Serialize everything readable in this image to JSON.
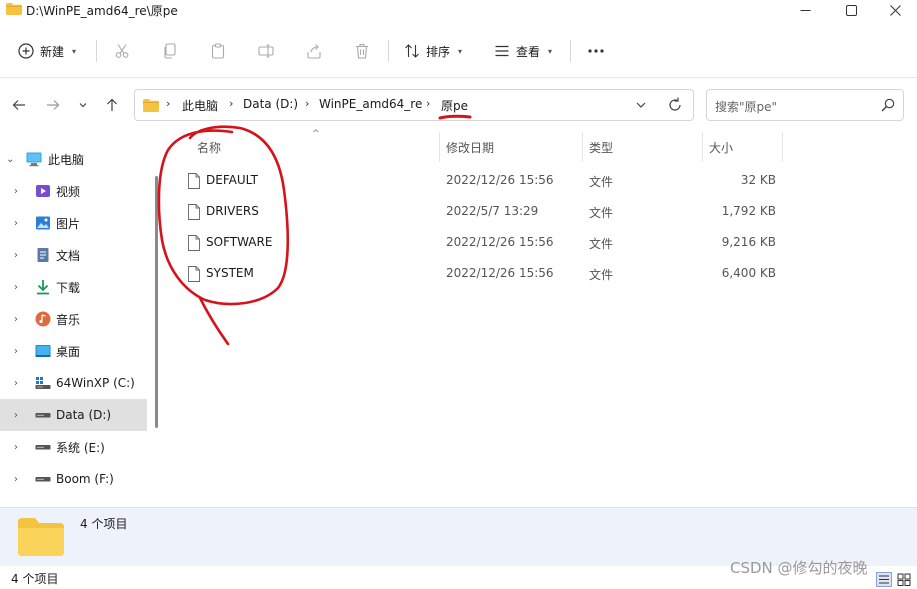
{
  "window": {
    "title": "D:\\WinPE_amd64_re\\原pe"
  },
  "toolbar": {
    "new_label": "新建",
    "sort_label": "排序",
    "view_label": "查看"
  },
  "address": {
    "crumbs": [
      "此电脑",
      "Data (D:)",
      "WinPE_amd64_re",
      "原pe"
    ],
    "search_placeholder": "搜索\"原pe\""
  },
  "sidebar": {
    "items": [
      {
        "label": "此电脑",
        "icon": "computer-icon"
      },
      {
        "label": "视频",
        "icon": "video-icon"
      },
      {
        "label": "图片",
        "icon": "pictures-icon"
      },
      {
        "label": "文档",
        "icon": "documents-icon"
      },
      {
        "label": "下载",
        "icon": "download-icon"
      },
      {
        "label": "音乐",
        "icon": "music-icon"
      },
      {
        "label": "桌面",
        "icon": "desktop-icon"
      },
      {
        "label": "64WinXP  (C:)",
        "icon": "drive-icon"
      },
      {
        "label": "Data (D:)",
        "icon": "drive-icon"
      },
      {
        "label": "系统 (E:)",
        "icon": "drive-icon"
      },
      {
        "label": "Boom (F:)",
        "icon": "drive-icon"
      }
    ]
  },
  "columns": {
    "name": "名称",
    "modified": "修改日期",
    "type": "类型",
    "size": "大小"
  },
  "files": [
    {
      "name": "DEFAULT",
      "modified": "2022/12/26 15:56",
      "type": "文件",
      "size": "32 KB"
    },
    {
      "name": "DRIVERS",
      "modified": "2022/5/7 13:29",
      "type": "文件",
      "size": "1,792 KB"
    },
    {
      "name": "SOFTWARE",
      "modified": "2022/12/26 15:56",
      "type": "文件",
      "size": "9,216 KB"
    },
    {
      "name": "SYSTEM",
      "modified": "2022/12/26 15:56",
      "type": "文件",
      "size": "6,400 KB"
    }
  ],
  "details": {
    "count": "4 个项目"
  },
  "status": {
    "count": "4 个项目"
  },
  "watermark": "CSDN @修勾的夜晚",
  "colors": {
    "selected_bg": "#e0e0e0",
    "details_bg": "#eef2fb",
    "folder": "#f5c342",
    "annotation": "#d4131b"
  }
}
